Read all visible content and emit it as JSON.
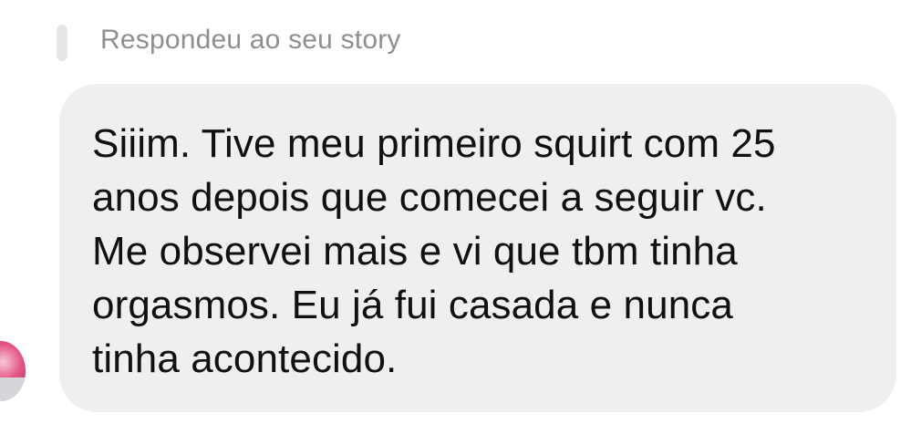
{
  "reply_header": {
    "label": "Respondeu ao seu story"
  },
  "message": {
    "text": "Siiim. Tive meu primeiro squirt com 25\nanos depois que comecei a seguir vc.\nMe observei mais e vi que tbm tinha\norgasmos. Eu já fui casada e nunca\ntinha acontecido."
  },
  "colors": {
    "bubble_background": "#efeff1",
    "reply_label": "#8e8e93",
    "reply_bar": "#e6e6e9",
    "message_text": "#111111"
  },
  "icons": {
    "avatar": "sender-avatar"
  }
}
